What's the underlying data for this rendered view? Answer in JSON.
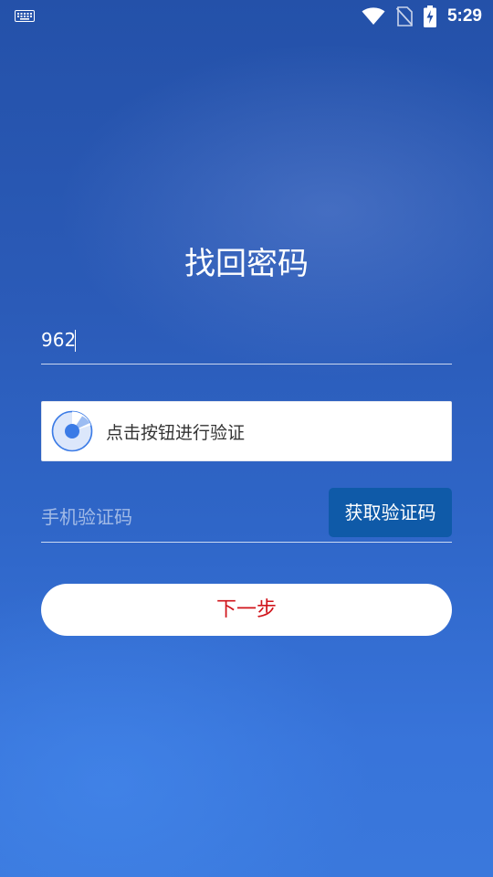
{
  "status_bar": {
    "time": "5:29",
    "icons": [
      "keyboard-icon",
      "wifi-icon",
      "no-sim-icon",
      "battery-charging-icon"
    ]
  },
  "page": {
    "title": "找回密码"
  },
  "form": {
    "account_value": "962",
    "verify_label": "点击按钮进行验证",
    "sms_placeholder": "手机验证码",
    "get_code_label": "获取验证码",
    "next_label": "下一步"
  },
  "colors": {
    "background_top": "#2451a9",
    "background_bottom": "#3a78dc",
    "get_code_button": "#0f5aa8",
    "next_text": "#d0141b",
    "verify_icon": "#3b7be6"
  }
}
